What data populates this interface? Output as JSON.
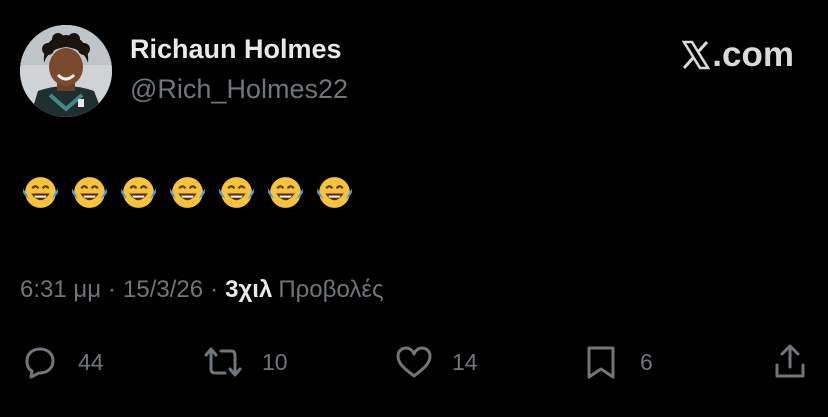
{
  "author": {
    "display_name": "Richaun Holmes",
    "handle": "@Rich_Holmes22"
  },
  "brand": {
    "logo_icon": "x-logo-icon",
    "text": ".com"
  },
  "tweet": {
    "emoji_name": "face-with-tears-of-joy",
    "emoji_count": 7
  },
  "meta": {
    "time": "6:31 μμ",
    "separator": "·",
    "date": "15/3/26",
    "views_count": "3χιλ",
    "views_label": "Προβολές"
  },
  "actions": {
    "reply_count": "44",
    "repost_count": "10",
    "like_count": "14",
    "bookmark_count": "6"
  },
  "colors": {
    "background": "#000000",
    "primary_text": "#e7e9ea",
    "secondary_text": "#71767b",
    "emoji_yellow": "#f7c33a",
    "emoji_tears": "#4a9be0"
  }
}
